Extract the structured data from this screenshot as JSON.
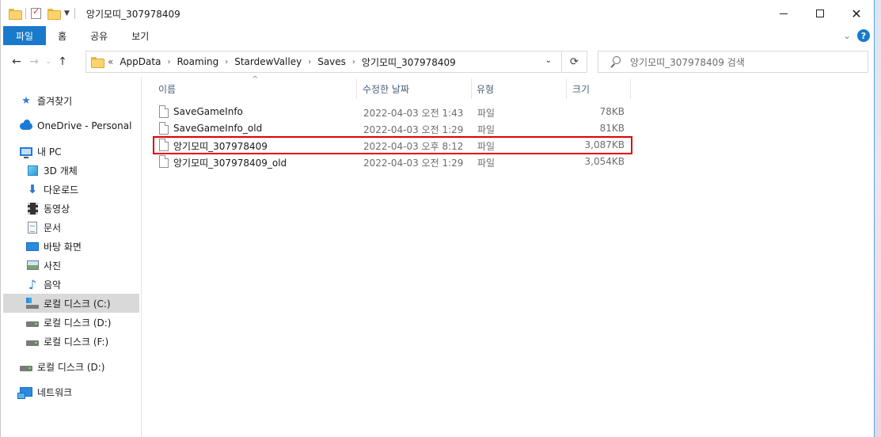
{
  "window": {
    "title": "앙기모띠_307978409",
    "buttons": [
      "minimize",
      "maximize",
      "close"
    ]
  },
  "quick_access": [
    "folder-icon",
    "properties-icon",
    "new-folder-icon"
  ],
  "ribbon": {
    "tabs": [
      "파일",
      "홈",
      "공유",
      "보기"
    ],
    "help": "?"
  },
  "address": {
    "prefix": "«",
    "crumbs": [
      "AppData",
      "Roaming",
      "StardewValley",
      "Saves",
      "앙기모띠_307978409"
    ],
    "search_placeholder": "앙기모띠_307978409 검색"
  },
  "sidebar": {
    "items": [
      {
        "label": "즐겨찾기",
        "icon": "star-icon"
      },
      {
        "label": "OneDrive - Personal",
        "icon": "cloud-icon"
      },
      {
        "label": "내 PC",
        "icon": "pc-icon"
      },
      {
        "label": "3D 개체",
        "icon": "cube-icon"
      },
      {
        "label": "다운로드",
        "icon": "download-icon"
      },
      {
        "label": "동영상",
        "icon": "video-icon"
      },
      {
        "label": "문서",
        "icon": "document-icon"
      },
      {
        "label": "바탕 화면",
        "icon": "desktop-icon"
      },
      {
        "label": "사진",
        "icon": "picture-icon"
      },
      {
        "label": "음악",
        "icon": "music-icon"
      },
      {
        "label": "로컬 디스크 (C:)",
        "icon": "system-drive-icon",
        "selected": true
      },
      {
        "label": "로컬 디스크 (D:)",
        "icon": "drive-icon"
      },
      {
        "label": "로컬 디스크 (F:)",
        "icon": "drive-icon"
      },
      {
        "label": "로컬 디스크 (D:)",
        "icon": "drive-icon"
      },
      {
        "label": "네트워크",
        "icon": "network-icon"
      }
    ]
  },
  "columns": [
    "이름",
    "수정한 날짜",
    "유형",
    "크기"
  ],
  "files": [
    {
      "name": "SaveGameInfo",
      "date": "2022-04-03 오전 1:43",
      "type": "파일",
      "size": "78KB"
    },
    {
      "name": "SaveGameInfo_old",
      "date": "2022-04-03 오전 1:29",
      "type": "파일",
      "size": "81KB"
    },
    {
      "name": "앙기모띠_307978409",
      "date": "2022-04-03 오후 8:12",
      "type": "파일",
      "size": "3,087KB",
      "highlighted": true
    },
    {
      "name": "앙기모띠_307978409_old",
      "date": "2022-04-03 오전 1:29",
      "type": "파일",
      "size": "3,054KB"
    }
  ],
  "colors": {
    "accent": "#1979ca",
    "highlight_box": "#e00000",
    "selected_nav": "#d9d9d9"
  }
}
